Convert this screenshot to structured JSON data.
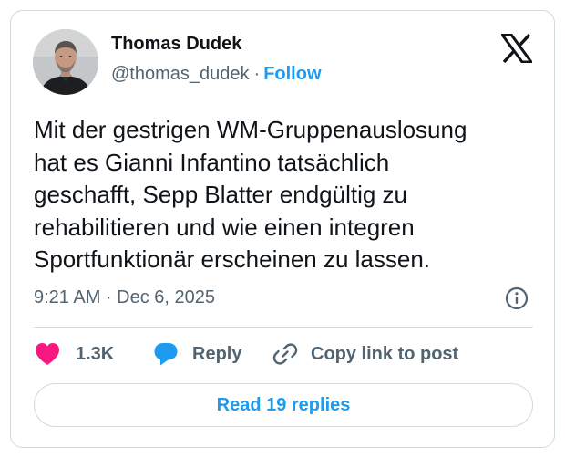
{
  "author": {
    "name": "Thomas Dudek",
    "handle": "@thomas_dudek",
    "separator": "·",
    "follow_label": "Follow",
    "avatar_icon": "person-avatar"
  },
  "brand": {
    "logo_icon": "x-logo-icon"
  },
  "tweet": {
    "text_lines": [
      "Mit der gestrigen WM-Gruppenauslosung",
      "hat es Gianni Infantino tatsächlich",
      "geschafft, Sepp Blatter endgültig zu",
      "rehabilitieren und wie einen integren",
      "Sportfunktionär erscheinen zu lassen."
    ],
    "timestamp": "9:21 AM · Dec 6, 2025",
    "info_icon": "info-icon"
  },
  "actions": {
    "likes": "1.3K",
    "reply_label": "Reply",
    "copy_label": "Copy link to post",
    "like_icon": "heart-icon",
    "reply_icon": "speech-bubble-icon",
    "copy_icon": "link-icon"
  },
  "footer": {
    "read_replies_label": "Read 19 replies"
  },
  "colors": {
    "accent": "#1d9bf0",
    "like": "#f91880",
    "text": "#0f1419",
    "secondary": "#536471",
    "border": "#cfd9de"
  }
}
